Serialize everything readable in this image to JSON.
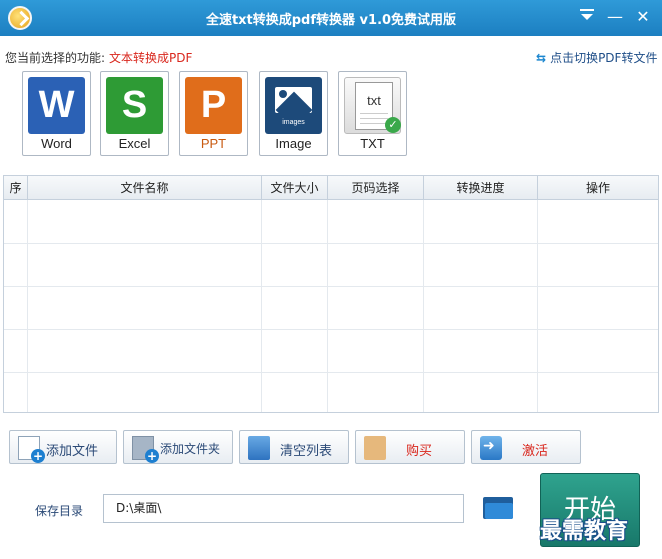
{
  "window": {
    "title": "全速txt转换成pdf转换器 v1.0免费试用版",
    "menu_icon": "dropdown-menu-icon",
    "minimize_label": "—",
    "close_label": "✕"
  },
  "function_bar": {
    "label": "您当前选择的功能:",
    "value": "文本转换成PDF",
    "switch_link": "点击切换PDF转文件"
  },
  "formats": [
    {
      "label": "Word",
      "glyph": "W",
      "icon": "word-icon",
      "color": "#2b61b5"
    },
    {
      "label": "Excel",
      "glyph": "S",
      "icon": "excel-icon",
      "color": "#2e9b35"
    },
    {
      "label": "PPT",
      "glyph": "P",
      "icon": "ppt-icon",
      "color": "#e06d1b"
    },
    {
      "label": "Image",
      "caption": "images",
      "icon": "image-icon",
      "color": "#1d4a7a"
    },
    {
      "label": "TXT",
      "caption": "txt",
      "icon": "txt-icon",
      "color": "#3aa84a"
    }
  ],
  "table": {
    "columns": [
      "序",
      "文件名称",
      "文件大小",
      "页码选择",
      "转换进度",
      "操作"
    ],
    "rows": []
  },
  "actions": {
    "add_file": "添加文件",
    "add_folder": "添加文件夹",
    "clear_list": "清空列表",
    "buy": "购买",
    "activate": "激活"
  },
  "save": {
    "label": "保存目录",
    "path": "D:\\桌面\\"
  },
  "start_button": "开始",
  "watermark": "最需教育"
}
